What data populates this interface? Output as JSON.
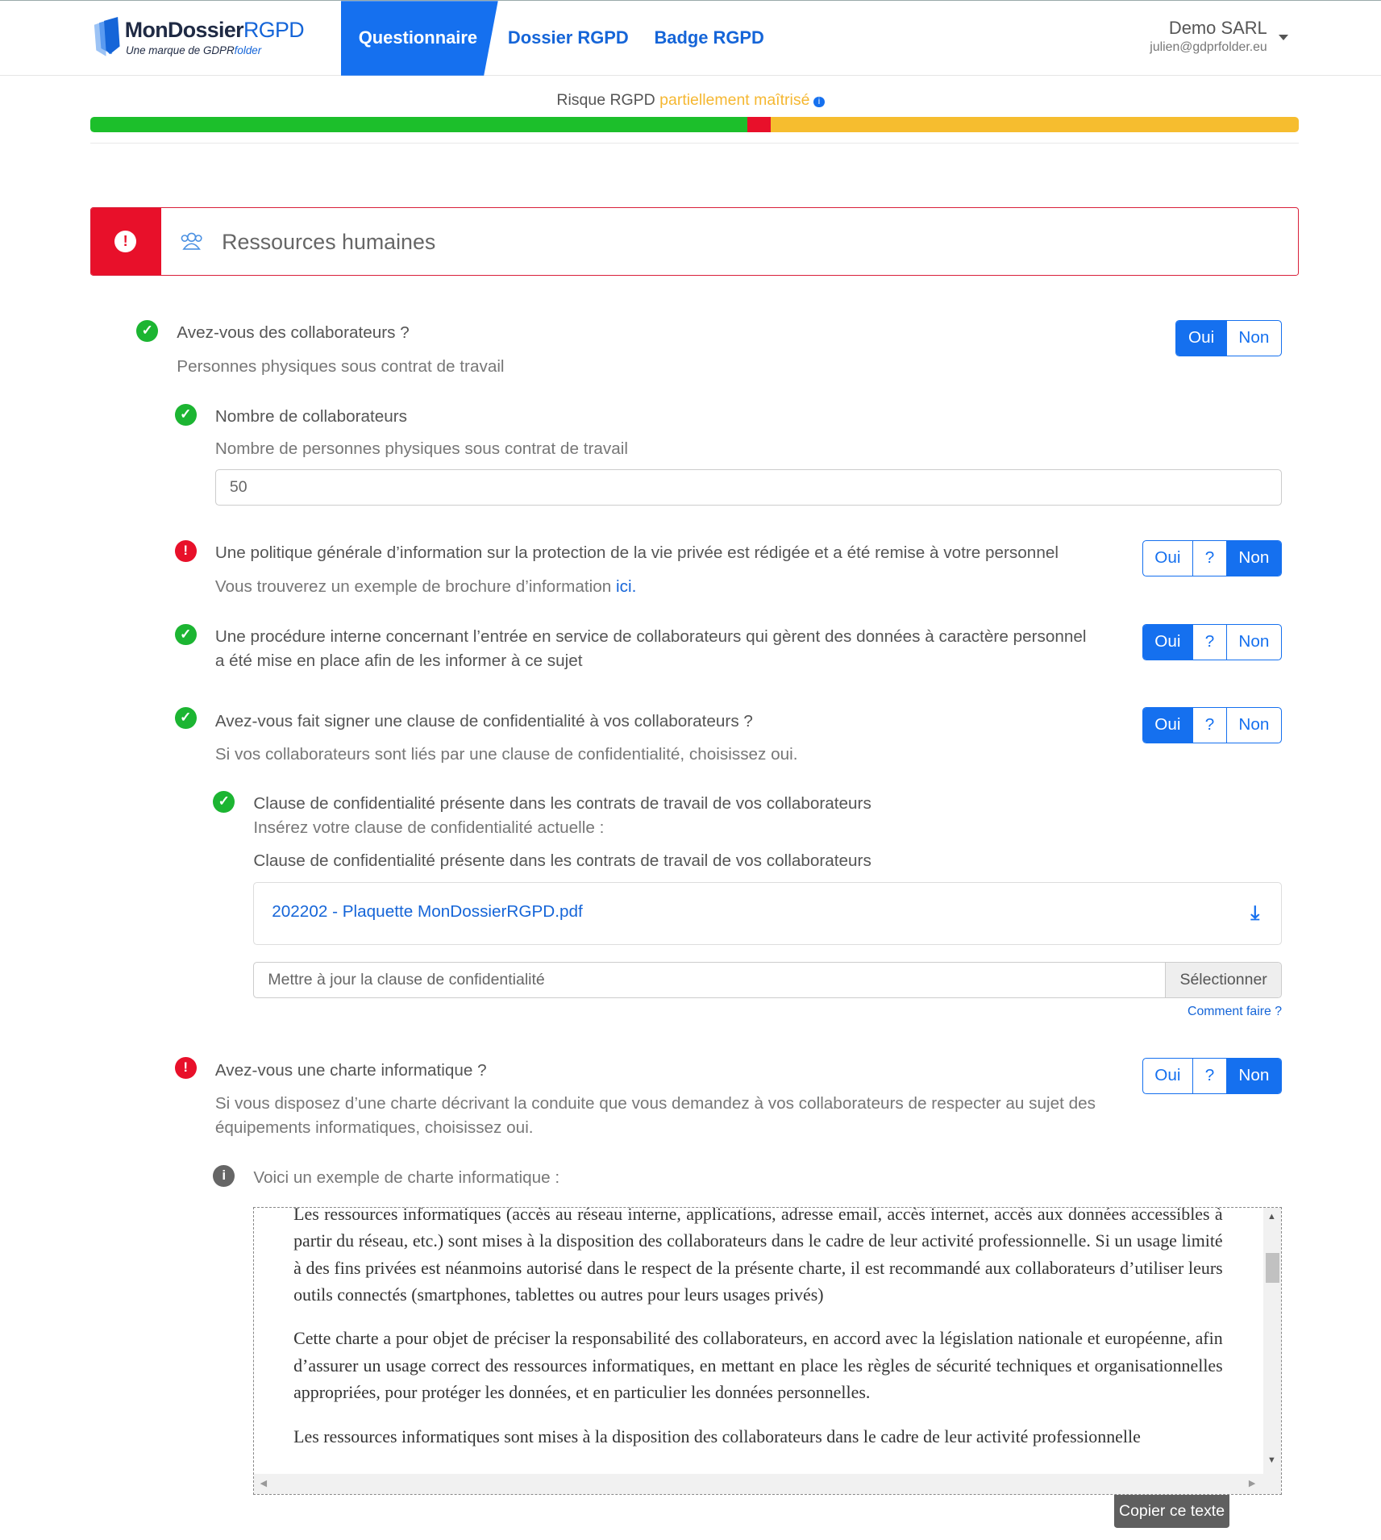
{
  "header": {
    "logo": {
      "part1": "MonDossier",
      "part2": "RGPD",
      "tagline_prefix": "Une marque de GDPR",
      "tagline_suffix": "folder"
    },
    "nav": [
      {
        "label": "Questionnaire",
        "active": true
      },
      {
        "label": "Dossier RGPD"
      },
      {
        "label": "Badge RGPD"
      }
    ],
    "user": {
      "company": "Demo SARL",
      "email": "julien@gdprfolder.eu"
    }
  },
  "risk": {
    "prefix": "Risque RGPD",
    "status": "partiellement maîtrisé",
    "info_icon": "i",
    "segments": [
      {
        "color": "#1cbf2b",
        "percent": 54.4
      },
      {
        "color": "#e8102a",
        "percent": 1.9
      },
      {
        "color": "#f6bd2f",
        "percent": 43.7
      }
    ]
  },
  "section": {
    "title": "Ressources humaines",
    "status_icon": "exclamation-circle",
    "icon": "users-icon"
  },
  "questions": [
    {
      "status": "ok",
      "label": "Avez-vous des collaborateurs ?",
      "hint": "Personnes physiques sous contrat de travail",
      "options": [
        "Oui",
        "Non"
      ],
      "selected": "Oui"
    },
    {
      "status": "ok",
      "label": "Nombre de collaborateurs",
      "hint": "Nombre de personnes physiques sous contrat de travail",
      "value": "50"
    },
    {
      "status": "ko",
      "label": "Une politique générale d’information sur la protection de la vie privée est rédigée et a été remise à votre personnel",
      "hint": "Vous trouverez un exemple de brochure d’information ",
      "hint_link": "ici",
      "hint_end": ".",
      "options": [
        "Oui",
        "?",
        "Non"
      ],
      "selected": "Non"
    },
    {
      "status": "ok",
      "label": "Une procédure interne concernant l’entrée en service de collaborateurs qui gèrent des données à caractère personnel a été mise en place afin de les informer à ce sujet",
      "options": [
        "Oui",
        "?",
        "Non"
      ],
      "selected": "Oui"
    },
    {
      "status": "ok",
      "label": "Avez-vous fait signer une clause de confidentialité à vos collaborateurs ?",
      "hint": "Si vos collaborateurs sont liés par une clause de confidentialité, choisissez oui.",
      "options": [
        "Oui",
        "?",
        "Non"
      ],
      "selected": "Oui"
    },
    {
      "status": "ok",
      "label": "Clause de confidentialité présente dans les contrats de travail de vos collaborateurs",
      "hint": "Insérez votre clause de confidentialité actuelle :",
      "file_label": "Clause de confidentialité présente dans les contrats de travail de vos collaborateurs",
      "file_name": "202202 - Plaquette MonDossierRGPD.pdf",
      "upload_placeholder": "Mettre à jour la clause de confidentialité",
      "upload_button": "Sélectionner",
      "help_link": "Comment faire ?"
    },
    {
      "status": "ko",
      "label": "Avez-vous une charte informatique ?",
      "hint": "Si vous disposez d’une charte décrivant la conduite que vous demandez à vos collaborateurs de respecter au sujet des équipements informatiques, choisissez oui.",
      "options": [
        "Oui",
        "?",
        "Non"
      ],
      "selected": "Non"
    }
  ],
  "example": {
    "label": "Voici un exemple de charte informatique :",
    "paragraphs": [
      "Les ressources informatiques (accès au réseau interne, applications, adresse email, accès internet, accès aux données accessibles à partir du réseau, etc.) sont mises à la disposition des collaborateurs dans le cadre de leur activité professionnelle. Si un usage limité à des fins privées est néanmoins autorisé dans le respect de la présente charte, il est recommandé aux collaborateurs d’utiliser leurs outils connectés (smartphones, tablettes ou autres pour leurs usages privés)",
      "Cette charte a pour objet de préciser la responsabilité des collaborateurs, en accord avec la législation nationale et européenne, afin d’assurer un usage correct des ressources informatiques, en mettant en place les règles de sécurité techniques et organisationnelles appropriées, pour protéger les données, et en particulier les données personnelles.",
      "Les ressources informatiques sont mises à la disposition des collaborateurs dans le cadre de leur activité professionnelle"
    ],
    "copy_button": "Copier ce texte"
  }
}
